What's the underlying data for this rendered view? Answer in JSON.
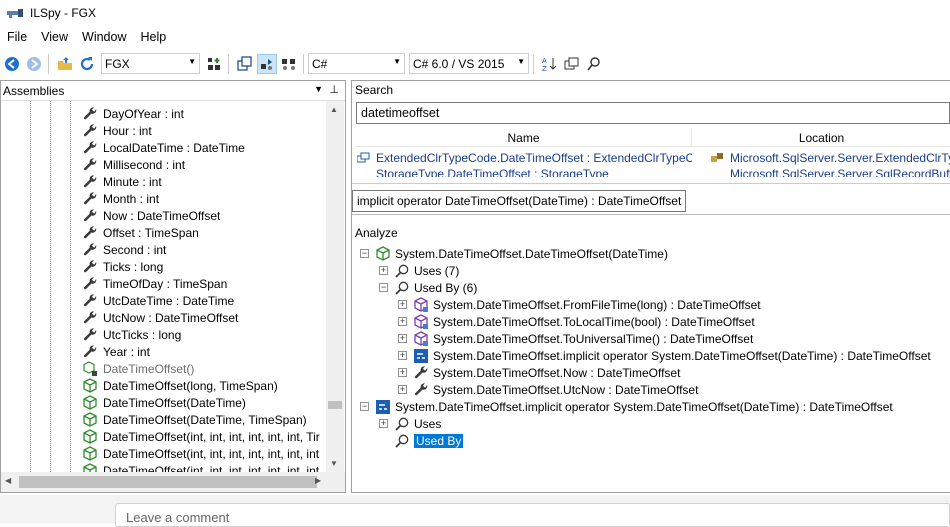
{
  "window": {
    "title": "ILSpy - FGX"
  },
  "menu": [
    "File",
    "View",
    "Window",
    "Help"
  ],
  "toolbar": {
    "assembly_list": "FGX",
    "language": "C#",
    "version": "C# 6.0 / VS 2015"
  },
  "assemblies_pane": {
    "title": "Assemblies",
    "items": [
      {
        "label": "DayOfYear : int",
        "icon": "property-wrench-icon"
      },
      {
        "label": "Hour : int",
        "icon": "property-wrench-icon"
      },
      {
        "label": "LocalDateTime : DateTime",
        "icon": "property-wrench-icon"
      },
      {
        "label": "Millisecond : int",
        "icon": "property-wrench-icon"
      },
      {
        "label": "Minute : int",
        "icon": "property-wrench-icon"
      },
      {
        "label": "Month : int",
        "icon": "property-wrench-icon"
      },
      {
        "label": "Now : DateTimeOffset",
        "icon": "property-wrench-icon"
      },
      {
        "label": "Offset : TimeSpan",
        "icon": "property-wrench-icon"
      },
      {
        "label": "Second : int",
        "icon": "property-wrench-icon"
      },
      {
        "label": "Ticks : long",
        "icon": "property-wrench-icon"
      },
      {
        "label": "TimeOfDay : TimeSpan",
        "icon": "property-wrench-icon"
      },
      {
        "label": "UtcDateTime : DateTime",
        "icon": "property-wrench-icon"
      },
      {
        "label": "UtcNow : DateTimeOffset",
        "icon": "property-wrench-icon"
      },
      {
        "label": "UtcTicks : long",
        "icon": "property-wrench-icon"
      },
      {
        "label": "Year : int",
        "icon": "property-wrench-icon"
      },
      {
        "label": "DateTimeOffset()",
        "icon": "private-method-cube-icon",
        "muted": true
      },
      {
        "label": "DateTimeOffset(long, TimeSpan)",
        "icon": "method-cube-icon"
      },
      {
        "label": "DateTimeOffset(DateTime)",
        "icon": "method-cube-icon"
      },
      {
        "label": "DateTimeOffset(DateTime, TimeSpan)",
        "icon": "method-cube-icon"
      },
      {
        "label": "DateTimeOffset(int, int, int, int, int, int, Tir",
        "icon": "method-cube-icon"
      },
      {
        "label": "DateTimeOffset(int, int, int, int, int, int, int",
        "icon": "method-cube-icon"
      },
      {
        "label": "DateTimeOffset(int, int, int, int, int, int, int",
        "icon": "method-cube-icon"
      }
    ]
  },
  "search": {
    "title": "Search",
    "query": "datetimeoffset",
    "columns": [
      "Name",
      "Location"
    ],
    "results": [
      {
        "name": "ExtendedClrTypeCode.DateTimeOffset : ExtendedClrTypeC",
        "location": "Microsoft.SqlServer.Server.ExtendedClrType"
      },
      {
        "name": "StorageType.DateTimeOffset : StorageType",
        "location": "Microsoft.SqlServer.Server.SqlRecordBuffer"
      }
    ]
  },
  "tooltip": "implicit operator DateTimeOffset(DateTime) : DateTimeOffset",
  "analyze": {
    "title": "Analyze",
    "nodes": [
      {
        "label": "System.DateTimeOffset.DateTimeOffset(DateTime)",
        "expander": "−",
        "icon": "method-cube-icon",
        "depth": 0
      },
      {
        "label": "Uses (7)",
        "expander": "+",
        "icon": "search-icon",
        "depth": 1
      },
      {
        "label": "Used By (6)",
        "expander": "−",
        "icon": "search-icon",
        "depth": 1
      },
      {
        "label": "System.DateTimeOffset.FromFileTime(long) : DateTimeOffset",
        "expander": "+",
        "icon": "static-method-icon",
        "depth": 2
      },
      {
        "label": "System.DateTimeOffset.ToLocalTime(bool) : DateTimeOffset",
        "expander": "+",
        "icon": "static-method-icon",
        "depth": 2
      },
      {
        "label": "System.DateTimeOffset.ToUniversalTime() : DateTimeOffset",
        "expander": "+",
        "icon": "static-method-icon",
        "depth": 2
      },
      {
        "label": "System.DateTimeOffset.implicit operator System.DateTimeOffset(DateTime) : DateTimeOffset",
        "expander": "+",
        "icon": "operator-icon",
        "depth": 2
      },
      {
        "label": "System.DateTimeOffset.Now : DateTimeOffset",
        "expander": "+",
        "icon": "property-wrench-icon",
        "depth": 2
      },
      {
        "label": "System.DateTimeOffset.UtcNow : DateTimeOffset",
        "expander": "+",
        "icon": "property-wrench-icon",
        "depth": 2
      },
      {
        "label": "System.DateTimeOffset.implicit operator System.DateTimeOffset(DateTime) : DateTimeOffset",
        "expander": "−",
        "icon": "operator-icon",
        "depth": 0
      },
      {
        "label": "Uses",
        "expander": "+",
        "icon": "search-icon",
        "depth": 1
      },
      {
        "label": "Used By",
        "expander": "",
        "icon": "search-icon",
        "depth": 1,
        "selected": true
      }
    ]
  },
  "comment": {
    "placeholder": "Leave a comment"
  }
}
